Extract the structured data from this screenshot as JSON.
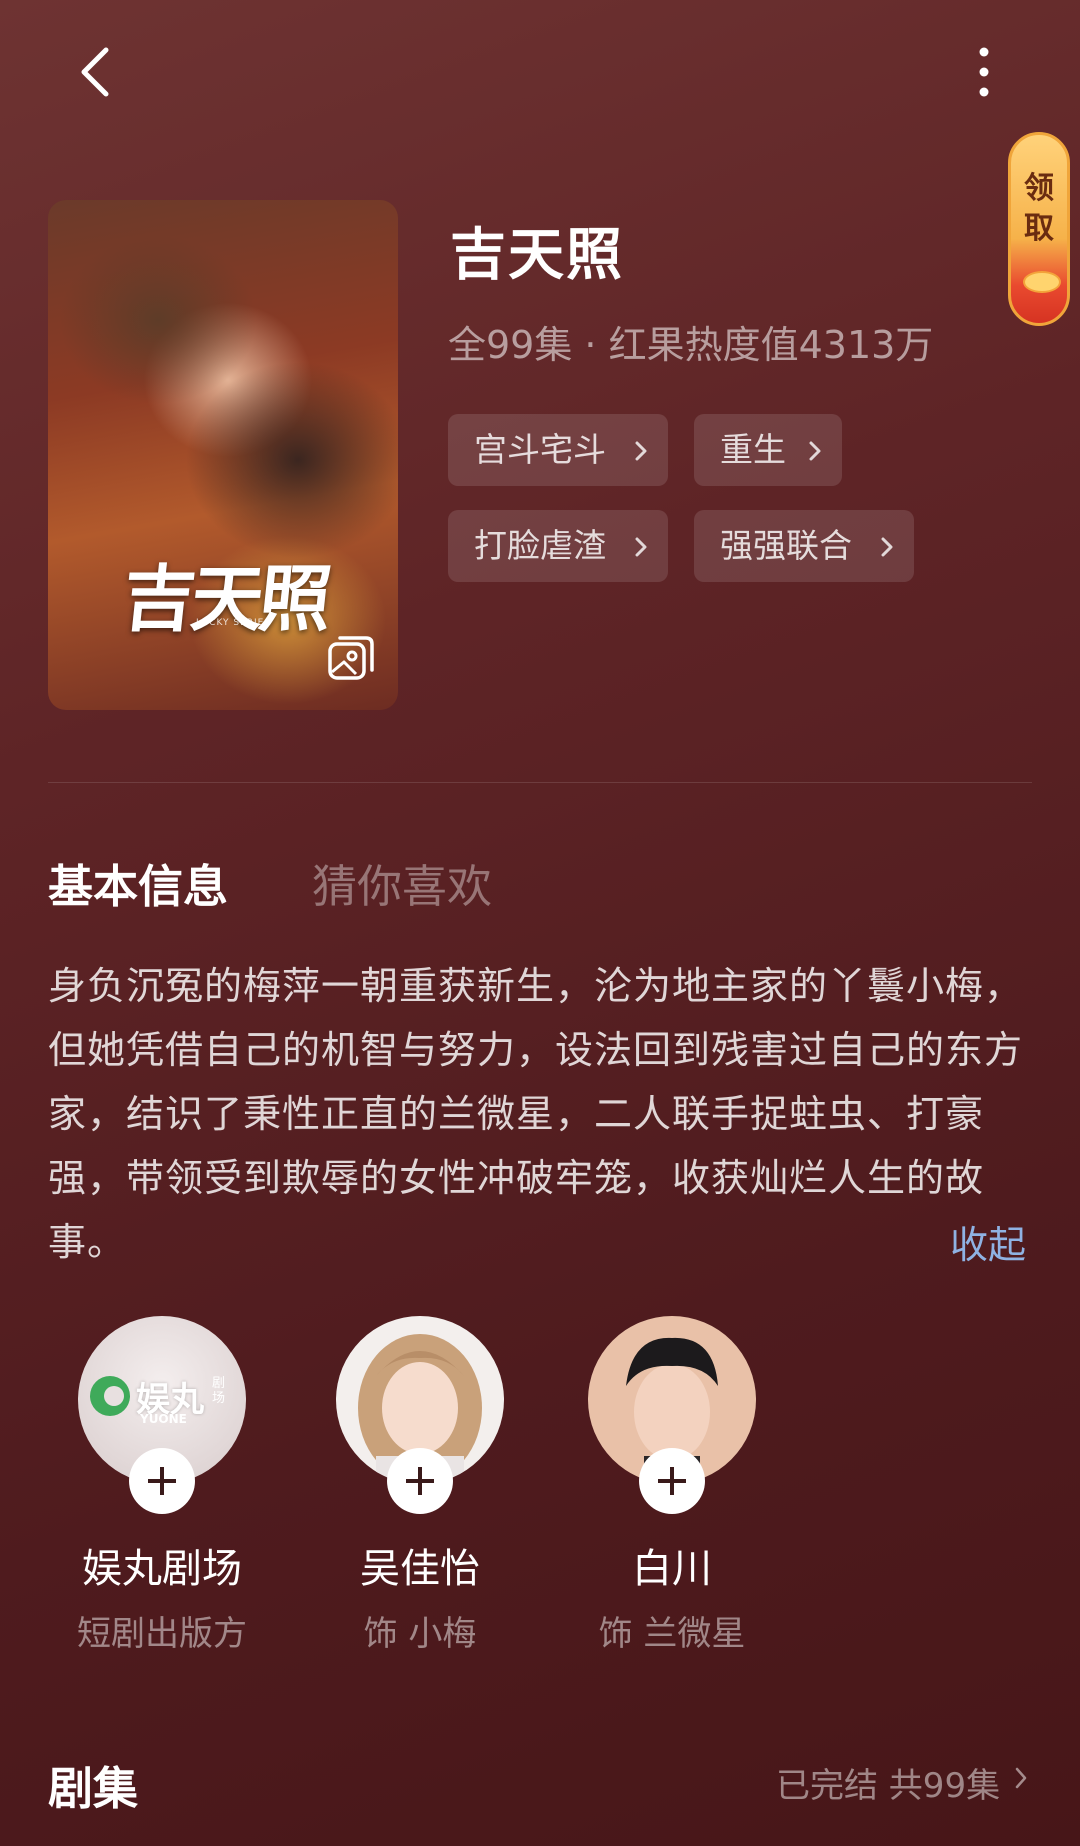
{
  "header": {
    "reward_label": "领取"
  },
  "cover": {
    "title_text": "吉天照",
    "subtitle_text": "LUCKY SERIES"
  },
  "drama": {
    "title": "吉天照",
    "meta": "全99集 · 红果热度值4313万",
    "tags": [
      "宫斗宅斗",
      "重生",
      "打脸虐渣",
      "强强联合"
    ]
  },
  "tabs": {
    "basic_info": "基本信息",
    "guess_you_like": "猜你喜欢"
  },
  "description": {
    "text": "身负沉冤的梅萍一朝重获新生，沦为地主家的丫鬟小梅，但她凭借自己的机智与努力，设法回到残害过自己的东方家，结识了秉性正直的兰微星，二人联手捉蛀虫、打豪强，带领受到欺辱的女性冲破牢笼，收获灿烂人生的故事。",
    "collapse_label": "收起"
  },
  "cast": [
    {
      "name": "娱丸剧场",
      "role": "短剧出版方",
      "logo_text": "娱丸",
      "logo_sub": "YUONE",
      "logo_side": "剧场"
    },
    {
      "name": "吴佳怡",
      "role": "饰 小梅"
    },
    {
      "name": "白川",
      "role": "饰 兰微星"
    }
  ],
  "episodes": {
    "title": "剧集",
    "status": "已完结 共99集"
  },
  "colors": {
    "background_top": "#6e3332",
    "background_bottom": "#471618",
    "link_blue": "#8fb2e3",
    "reward_gold": "#f6b24a",
    "reward_red": "#d63322"
  },
  "icons": [
    "back-arrow-icon",
    "more-vertical-icon",
    "gallery-icon",
    "chevron-right-icon",
    "plus-icon"
  ]
}
